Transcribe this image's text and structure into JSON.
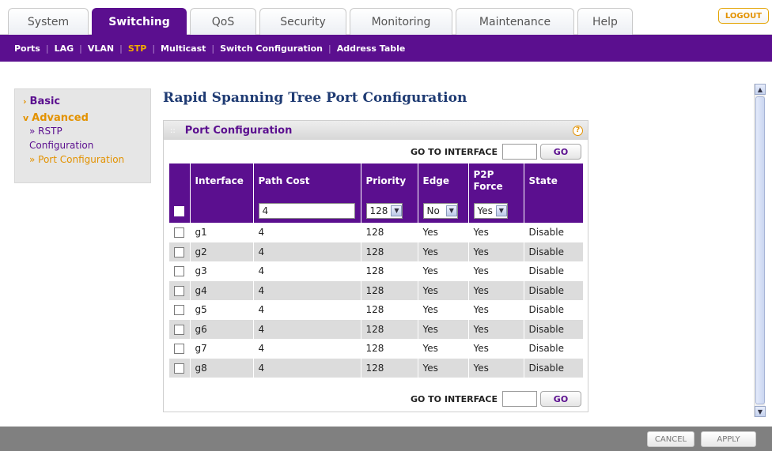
{
  "tabs": [
    {
      "label": "System",
      "active": false,
      "width": 102
    },
    {
      "label": "Switching",
      "active": true,
      "width": 120
    },
    {
      "label": "QoS",
      "active": false,
      "width": 84
    },
    {
      "label": "Security",
      "active": false,
      "width": 110
    },
    {
      "label": "Monitoring",
      "active": false,
      "width": 130
    },
    {
      "label": "Maintenance",
      "active": false,
      "width": 150
    },
    {
      "label": "Help",
      "active": false,
      "width": 70
    }
  ],
  "logout_label": "LOGOUT",
  "subnav": [
    {
      "label": "Ports",
      "active": false
    },
    {
      "label": "LAG",
      "active": false
    },
    {
      "label": "VLAN",
      "active": false
    },
    {
      "label": "STP",
      "active": true
    },
    {
      "label": "Multicast",
      "active": false
    },
    {
      "label": "Switch Configuration",
      "active": false
    },
    {
      "label": "Address Table",
      "active": false
    }
  ],
  "sidebar": {
    "basic": "Basic",
    "advanced": "Advanced",
    "rstp_line1": "» RSTP",
    "rstp_line2": "Configuration",
    "port_config": "» Port Configuration"
  },
  "page_title": "Rapid Spanning Tree Port Configuration",
  "panel": {
    "title": "Port Configuration",
    "help_icon": "?",
    "goto_label": "GO TO INTERFACE",
    "go_label": "GO",
    "goto_value": ""
  },
  "table": {
    "headers": [
      "Interface",
      "Path Cost",
      "Priority",
      "Edge",
      "P2P Force",
      "State"
    ],
    "edit_row": {
      "path_cost": "4",
      "priority": "128",
      "edge": "No",
      "p2p_force": "Yes"
    },
    "rows": [
      {
        "interface": "g1",
        "path_cost": "4",
        "priority": "128",
        "edge": "Yes",
        "p2p": "Yes",
        "state": "Disable"
      },
      {
        "interface": "g2",
        "path_cost": "4",
        "priority": "128",
        "edge": "Yes",
        "p2p": "Yes",
        "state": "Disable"
      },
      {
        "interface": "g3",
        "path_cost": "4",
        "priority": "128",
        "edge": "Yes",
        "p2p": "Yes",
        "state": "Disable"
      },
      {
        "interface": "g4",
        "path_cost": "4",
        "priority": "128",
        "edge": "Yes",
        "p2p": "Yes",
        "state": "Disable"
      },
      {
        "interface": "g5",
        "path_cost": "4",
        "priority": "128",
        "edge": "Yes",
        "p2p": "Yes",
        "state": "Disable"
      },
      {
        "interface": "g6",
        "path_cost": "4",
        "priority": "128",
        "edge": "Yes",
        "p2p": "Yes",
        "state": "Disable"
      },
      {
        "interface": "g7",
        "path_cost": "4",
        "priority": "128",
        "edge": "Yes",
        "p2p": "Yes",
        "state": "Disable"
      },
      {
        "interface": "g8",
        "path_cost": "4",
        "priority": "128",
        "edge": "Yes",
        "p2p": "Yes",
        "state": "Disable"
      }
    ]
  },
  "footer": {
    "cancel_label": "CANCEL",
    "apply_label": "APPLY"
  },
  "colors": {
    "brand_purple": "#5b0f8f",
    "accent_orange": "#e39200",
    "title_blue": "#1f3b73"
  }
}
